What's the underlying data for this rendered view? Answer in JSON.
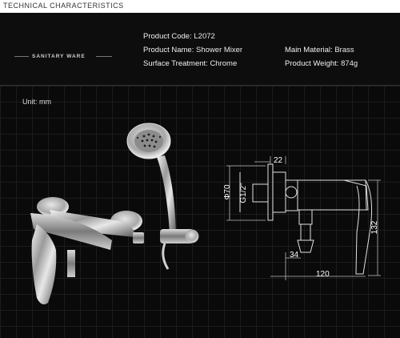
{
  "header": {
    "section_title": "TECHNICAL CHARACTERISTICS",
    "brand": "SANITARY WARE"
  },
  "specs": {
    "product_code_label": "Product Code:",
    "product_code_value": "L2072",
    "product_name_label": "Product Name:",
    "product_name_value": "Shower Mixer",
    "surface_label": "Surface Treatment:",
    "surface_value": "Chrome",
    "material_label": "Main Material:",
    "material_value": "Brass",
    "weight_label": "Product Weight:",
    "weight_value": "874g"
  },
  "drawing": {
    "unit": "Unit: mm",
    "dim_top": "22",
    "dim_left_outer": "Φ70",
    "dim_left_inner": "G1/2\"",
    "dim_right": "132",
    "dim_mid": "34",
    "dim_bottom": "120"
  }
}
